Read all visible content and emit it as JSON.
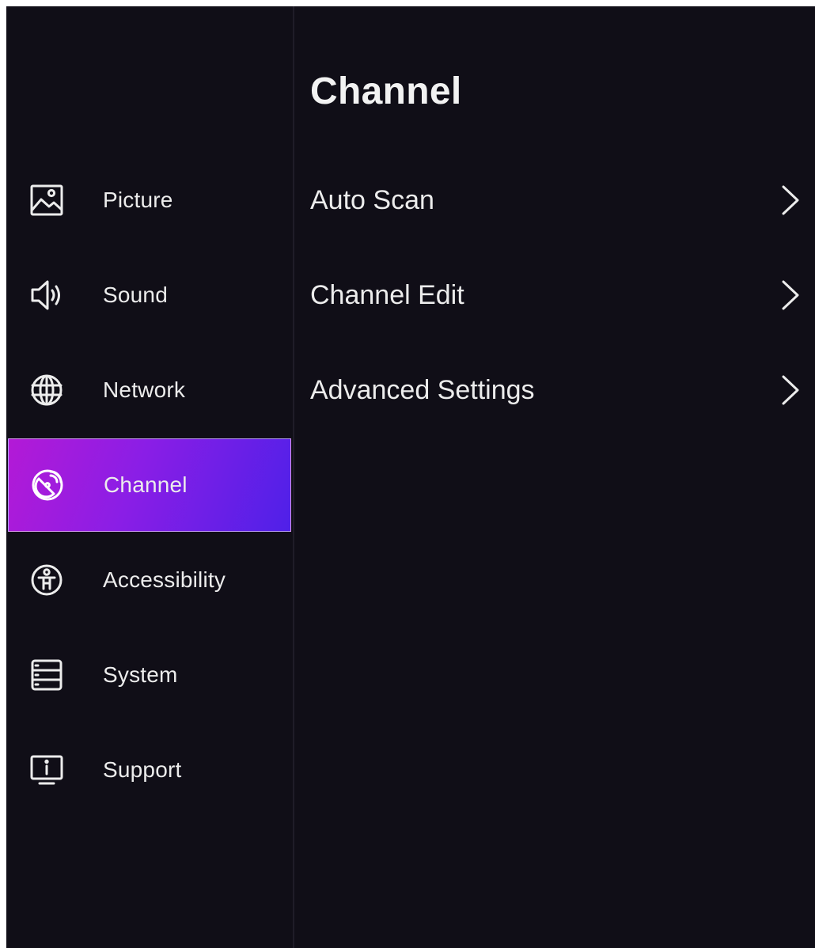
{
  "page": {
    "title": "Channel"
  },
  "sidebar": {
    "items": [
      {
        "label": "Picture",
        "icon": "picture-icon",
        "active": false
      },
      {
        "label": "Sound",
        "icon": "speaker-icon",
        "active": false
      },
      {
        "label": "Network",
        "icon": "globe-icon",
        "active": false
      },
      {
        "label": "Channel",
        "icon": "antenna-icon",
        "active": true
      },
      {
        "label": "Accessibility",
        "icon": "accessibility-icon",
        "active": false
      },
      {
        "label": "System",
        "icon": "system-icon",
        "active": false
      },
      {
        "label": "Support",
        "icon": "support-info-icon",
        "active": false
      }
    ]
  },
  "menu": {
    "items": [
      {
        "label": "Auto Scan",
        "icon": "chevron-right-icon"
      },
      {
        "label": "Channel Edit",
        "icon": "chevron-right-icon"
      },
      {
        "label": "Advanced Settings",
        "icon": "chevron-right-icon"
      }
    ]
  },
  "colors": {
    "background": "#100e17",
    "text": "#ececec",
    "active_gradient_start": "#b31ad6",
    "active_gradient_end": "#4f20e8"
  }
}
